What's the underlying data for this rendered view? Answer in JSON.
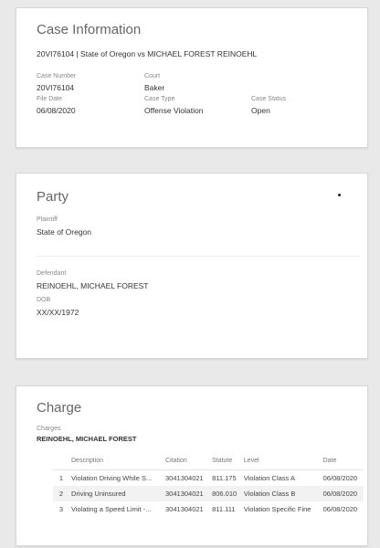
{
  "case_info": {
    "title": "Case Information",
    "heading": "20VI76104 | State of Oregon vs MICHAEL FOREST REINOEHL",
    "case_number_label": "Case Number",
    "case_number": "20VI76104",
    "court_label": "Court",
    "court": "Baker",
    "file_date_label": "File Date",
    "file_date": "06/08/2020",
    "case_type_label": "Case Type",
    "case_type": "Offense Violation",
    "case_status_label": "Case Status",
    "case_status": "Open"
  },
  "party": {
    "title": "Party",
    "plaintiff_label": "Plaintiff",
    "plaintiff": "State of Oregon",
    "defendant_label": "Defendant",
    "defendant": "REINOEHL, MICHAEL FOREST",
    "dob_label": "DOB",
    "dob": "XX/XX/1972"
  },
  "charge": {
    "title": "Charge",
    "charges_label": "Charges",
    "defendant": "REINOEHL, MICHAEL FOREST",
    "columns": [
      "",
      "Description",
      "Citation",
      "Statute",
      "Level",
      "Date"
    ],
    "rows": [
      [
        "1",
        "Violation Driving While S...",
        "3041304021",
        "811.175",
        "Violation Class A",
        "06/08/2020"
      ],
      [
        "2",
        "Driving Uninsured",
        "3041304021",
        "806.010",
        "Violation Class B",
        "06/08/2020"
      ],
      [
        "3",
        "Violating a Speed Limit -...",
        "3041304021",
        "811.111",
        "Violation Specific Fine",
        "06/08/2020"
      ]
    ]
  }
}
